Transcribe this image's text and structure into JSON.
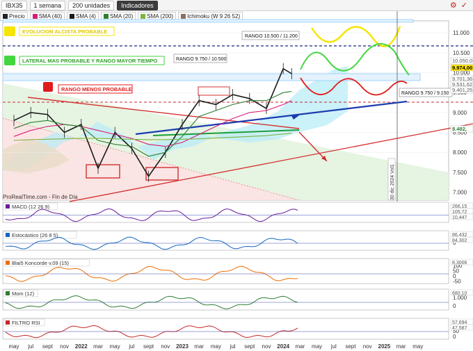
{
  "toolbar": {
    "symbol": "IBX35",
    "timeframe": "1 semana",
    "units": "200 unidades",
    "indicators": "Indicadores"
  },
  "legend": [
    {
      "label": "Precio",
      "color": "#222222"
    },
    {
      "label": "SMA (40)",
      "color": "#d81b7a"
    },
    {
      "label": "SMA (4)",
      "color": "#1a1a1a"
    },
    {
      "label": "SMA (20)",
      "color": "#2e7d32"
    },
    {
      "label": "SMA (200)",
      "color": "#7cb342"
    },
    {
      "label": "Ichimoku (W 9 26 52)",
      "color": "#8d6e63"
    }
  ],
  "annotations": {
    "bull": "EVOLUCION ALCISTA PROBABLE",
    "lateral": "LATERAL MAS PROBABLE Y RANGO MAYOR TIEMPO",
    "bear": "RANGO MENOS PROBABLE",
    "range_high": "RANGO 10.500 / 11.200",
    "range_mid": "RANGO 9.750 / 10.500",
    "range_low": "RANGO 9.750 / 9.150",
    "vline_label": "30 dic 2024 Vol1",
    "footer": "ProRealTime.com - Fin de Día"
  },
  "price_axis": {
    "ticks": [
      "11.000",
      "10.500",
      "10.000",
      "9.500",
      "9.000",
      "8.500",
      "8.000",
      "7.500",
      "7.000"
    ],
    "labels": [
      {
        "text": "10.050,0",
        "color": "#555555",
        "bg": "#ffffff"
      },
      {
        "text": "9.974,00",
        "color": "#000000",
        "bg": "#ffe600"
      },
      {
        "text": "9.701,36",
        "color": "#555555",
        "bg": "#ffffff"
      },
      {
        "text": "9.531,62",
        "color": "#555555",
        "bg": "#ffffff"
      },
      {
        "text": "9.401,25",
        "color": "#555555",
        "bg": "#ffffff"
      },
      {
        "text": "8.482,",
        "color": "#2e7d32",
        "bg": "#ffffff"
      }
    ]
  },
  "panels": [
    {
      "name": "MACD (12 26 9)",
      "ticks": [
        "0"
      ],
      "labels": [
        "266,15",
        "105,72",
        "10,447"
      ]
    },
    {
      "name": "Estocástico (26 8 5)",
      "ticks": [
        "0"
      ],
      "labels": [
        "86,432",
        "84,302"
      ]
    },
    {
      "name": "Blai5 Koncorde v.09 (15)",
      "ticks": [
        "100",
        "50",
        "0",
        "-50"
      ],
      "labels": [
        "8,3006"
      ]
    },
    {
      "name": "Mom (12)",
      "ticks": [
        "1.000",
        "0"
      ],
      "labels": [
        "680,10"
      ]
    },
    {
      "name": "FILTRO RSI",
      "ticks": [
        "100",
        "50",
        "0"
      ],
      "labels": [
        "57,694",
        "47,587"
      ]
    }
  ],
  "x_axis": [
    "may",
    "jul",
    "sept",
    "nov",
    "2022",
    "mar",
    "may",
    "jul",
    "sept",
    "nov",
    "2023",
    "mar",
    "may",
    "jul",
    "sept",
    "nov",
    "2024",
    "mar",
    "may",
    "jul",
    "sept",
    "nov",
    "2025",
    "mar",
    "may"
  ],
  "chart_data": {
    "type": "line",
    "title": "IBX35",
    "xlabel": "",
    "ylabel": "",
    "ylim": [
      6800,
      11300
    ],
    "x": [
      "2021-05",
      "2021-07",
      "2021-09",
      "2021-11",
      "2022-01",
      "2022-03",
      "2022-05",
      "2022-07",
      "2022-09",
      "2022-11",
      "2023-01",
      "2023-03",
      "2023-05",
      "2023-07",
      "2023-09",
      "2023-11",
      "2024-01",
      "2024-02"
    ],
    "series": [
      {
        "name": "Precio",
        "values": [
          8800,
          9000,
          8950,
          8500,
          8700,
          7600,
          8500,
          8100,
          7400,
          8000,
          8700,
          9300,
          9200,
          9450,
          9350,
          9100,
          10100,
          9974
        ]
      },
      {
        "name": "SMA (40)",
        "values": [
          8400,
          8550,
          8650,
          8700,
          8650,
          8550,
          8450,
          8350,
          8200,
          8150,
          8250,
          8450,
          8650,
          8850,
          9000,
          9050,
          9200,
          9300
        ]
      },
      {
        "name": "SMA (20)",
        "values": [
          8600,
          8750,
          8800,
          8700,
          8650,
          8300,
          8200,
          8150,
          7900,
          8000,
          8400,
          8900,
          9050,
          9200,
          9300,
          9300,
          9500,
          9530
        ]
      },
      {
        "name": "SMA (200)",
        "values": [
          8300,
          8320,
          8330,
          8340,
          8350,
          8350,
          8340,
          8330,
          8320,
          8320,
          8330,
          8340,
          8360,
          8380,
          8400,
          8420,
          8460,
          8482
        ]
      }
    ]
  }
}
